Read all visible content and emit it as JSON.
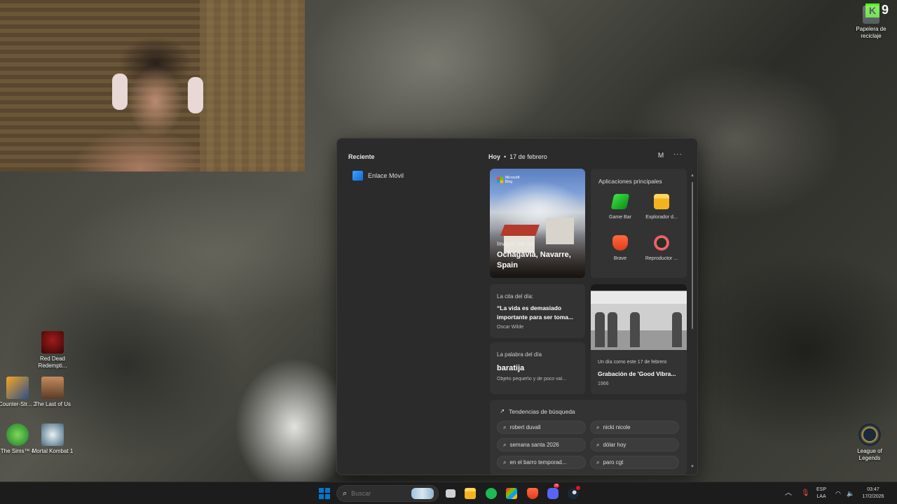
{
  "desktop": {
    "icons": [
      {
        "label": "Papelera de reciclaje",
        "icon": "recycle-bin-icon"
      },
      {
        "label": "Red Dead Redempti...",
        "icon": "red-dead-icon"
      },
      {
        "label": "Counter-Str... 2",
        "icon": "counter-strike-icon"
      },
      {
        "label": "The Last of Us",
        "icon": "the-last-of-us-icon"
      },
      {
        "label": "The Sims™ 4",
        "icon": "sims-icon"
      },
      {
        "label": "Mortal Kombat 1",
        "icon": "mortal-kombat-icon"
      },
      {
        "label": "League of Legends",
        "icon": "league-icon"
      }
    ],
    "overlay_badge": "9"
  },
  "widgets": {
    "recent_title": "Reciente",
    "recent_items": [
      {
        "label": "Enlace Móvil"
      }
    ],
    "date_today": "Hoy",
    "date_sep": "•",
    "date_value": "17 de febrero",
    "avatar_letter": "M",
    "more_label": "···",
    "photo_card": {
      "brand_line1": "Microsoft",
      "brand_line2": "Bing",
      "subtitle": "Imagen del día",
      "title": "Ochagavía, Navarre, Spain"
    },
    "apps_card": {
      "title": "Aplicaciones principales",
      "apps": [
        {
          "label": "Game Bar",
          "icon": "game-bar-icon",
          "color": "#10c21a"
        },
        {
          "label": "Explorador d...",
          "icon": "folder-icon",
          "color": "#f5c02a"
        },
        {
          "label": "Brave",
          "icon": "brave-icon",
          "color": "#f04a23"
        },
        {
          "label": "Reproductor ...",
          "icon": "media-player-icon",
          "color": "#e9498f"
        }
      ]
    },
    "quote_card": {
      "label": "La cita del día:",
      "quote": "“La vida es demasiado importante para ser toma...",
      "author": "Oscar Wilde"
    },
    "word_card": {
      "label": "La palabra del día",
      "word": "baratija",
      "definition": "Objeto pequeño y de poco val..."
    },
    "history_card": {
      "label": "Un día como este 17 de febrero",
      "title": "Grabación de 'Good Vibra...",
      "year": "1966"
    },
    "trends_card": {
      "title": "Tendencias de búsqueda",
      "chips": [
        "robert duvall",
        "nicki nicole",
        "semana santa 2026",
        "dólar hoy",
        "en el barro temporad...",
        "paro cgt"
      ]
    }
  },
  "taskbar": {
    "search_placeholder": "Buscar",
    "language_line1": "ESP",
    "language_line2": "LAA",
    "time": "03:47",
    "date": "17/2/2026",
    "discord_badge": "29",
    "accent": "#0078d4"
  }
}
